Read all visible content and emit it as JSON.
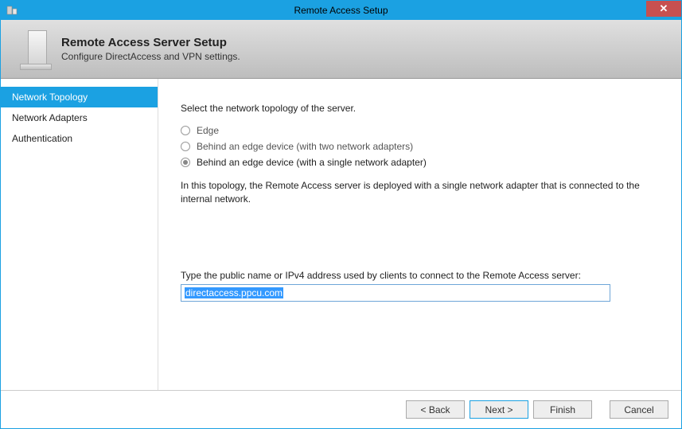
{
  "window": {
    "title": "Remote Access Setup",
    "close_label": "✕"
  },
  "banner": {
    "heading": "Remote Access Server Setup",
    "subheading": "Configure DirectAccess and VPN settings."
  },
  "sidebar": {
    "items": [
      {
        "label": "Network Topology",
        "selected": true
      },
      {
        "label": "Network Adapters",
        "selected": false
      },
      {
        "label": "Authentication",
        "selected": false
      }
    ]
  },
  "main": {
    "instruction": "Select the network topology of the server.",
    "options": [
      {
        "label": "Edge",
        "checked": false
      },
      {
        "label": "Behind an edge device (with two network adapters)",
        "checked": false
      },
      {
        "label": "Behind an edge device (with a single network adapter)",
        "checked": true
      }
    ],
    "description": "In this topology, the Remote Access server is deployed with a single network adapter that is connected to the internal network.",
    "address_label": "Type the public name or IPv4 address used by clients to connect to the Remote Access server:",
    "address_value": "directaccess.ppcu.com"
  },
  "footer": {
    "back": "< Back",
    "next": "Next >",
    "finish": "Finish",
    "cancel": "Cancel"
  }
}
